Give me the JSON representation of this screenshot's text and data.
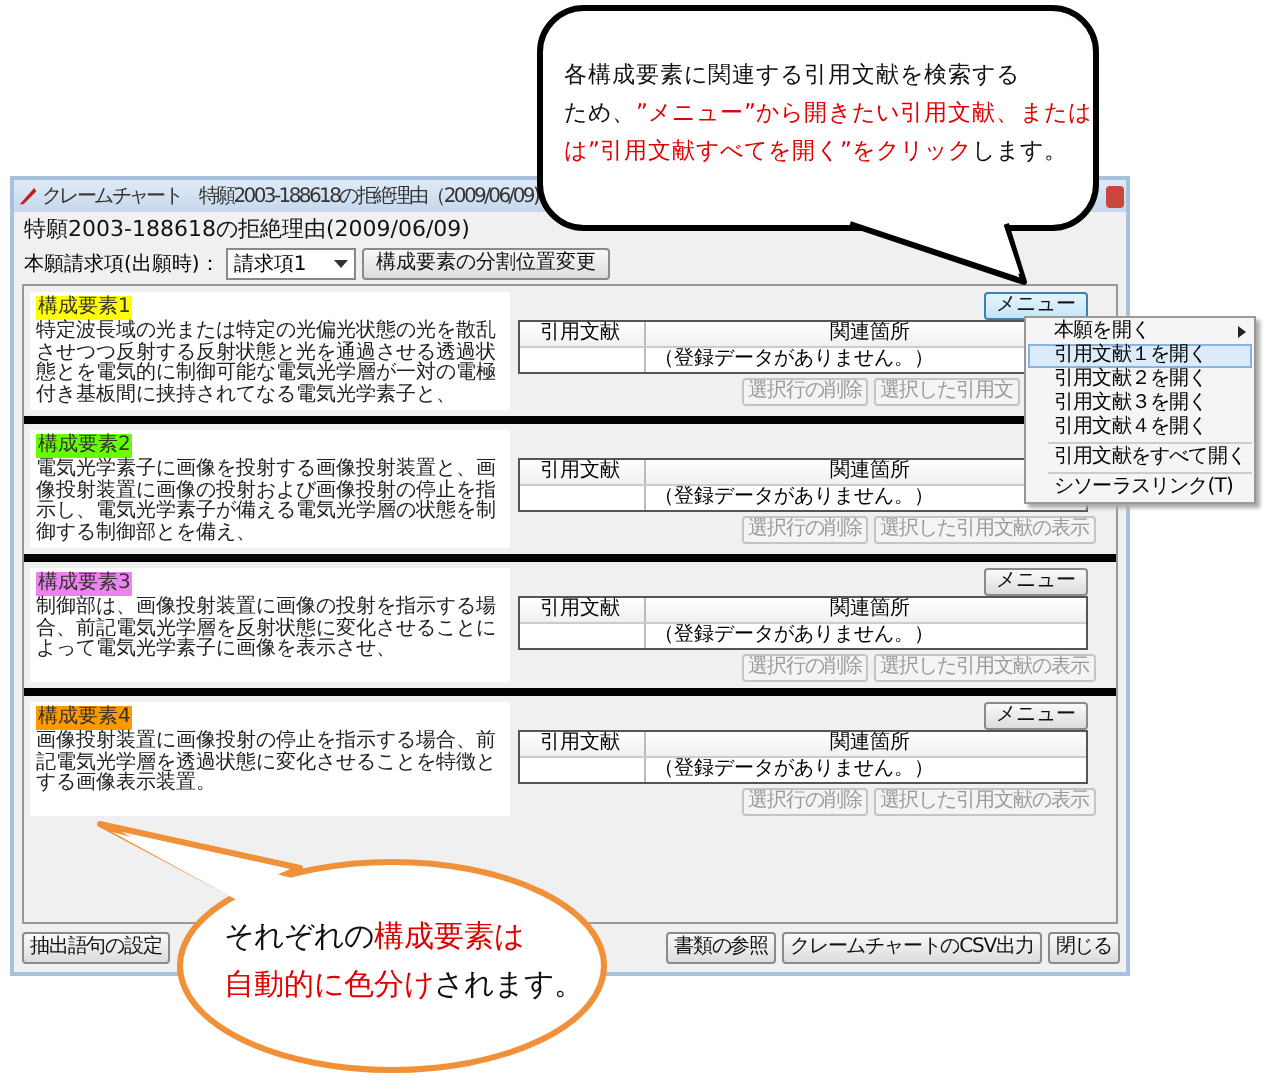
{
  "window": {
    "title": "クレームチャート　特願2003-188618の拒絶理由（2009/06/09)"
  },
  "heading": "特願2003-188618の拒絶理由(2009/06/09)",
  "claim_selector": {
    "label": "本願請求項(出願時)：",
    "value": "請求項1"
  },
  "split_button": "構成要素の分割位置変更",
  "sections": [
    {
      "label": "構成要素1",
      "color": "#ffff00",
      "text": "特定波長域の光または特定の光偏光状態の光を散乱させつつ反射する反射状態と光を通過させる透過状態とを電気的に制御可能な電気光学層が一対の電極付き基板間に挟持されてなる電気光学素子と、",
      "menu_button": {
        "label": "メニュー",
        "pressed": true
      },
      "columns": [
        "引用文献",
        "関連箇所"
      ],
      "empty_message": "（登録データがありません。）",
      "buttons": [
        {
          "label": "選択行の削除",
          "disabled": true
        },
        {
          "label": "選択した引用文",
          "disabled": true
        }
      ]
    },
    {
      "label": "構成要素2",
      "color": "#66ff00",
      "text": "電気光学素子に画像を投射する画像投射装置と、画像投射装置に画像の投射および画像投射の停止を指示し、電気光学素子が備える電気光学層の状態を制御する制御部とを備え、",
      "columns": [
        "引用文献",
        "関連箇所"
      ],
      "empty_message": "（登録データがありません。）",
      "buttons": [
        {
          "label": "選択行の削除",
          "disabled": true
        },
        {
          "label": "選択した引用文献の表示",
          "disabled": true
        }
      ]
    },
    {
      "label": "構成要素3",
      "color": "#ee82ee",
      "text": "制御部は、画像投射装置に画像の投射を指示する場合、前記電気光学層を反射状態に変化させることによって電気光学素子に画像を表示させ、",
      "menu_button": {
        "label": "メニュー",
        "pressed": false
      },
      "columns": [
        "引用文献",
        "関連箇所"
      ],
      "empty_message": "（登録データがありません。）",
      "buttons": [
        {
          "label": "選択行の削除",
          "disabled": true
        },
        {
          "label": "選択した引用文献の表示",
          "disabled": true
        }
      ]
    },
    {
      "label": "構成要素4",
      "color": "#ff9900",
      "text": "画像投射装置に画像投射の停止を指示する場合、前記電気光学層を透過状態に変化させることを特徴とする画像表示装置。",
      "menu_button": {
        "label": "メニュー",
        "pressed": false
      },
      "columns": [
        "引用文献",
        "関連箇所"
      ],
      "empty_message": "（登録データがありません。）",
      "buttons": [
        {
          "label": "選択行の削除",
          "disabled": true
        },
        {
          "label": "選択した引用文献の表示",
          "disabled": true
        }
      ]
    }
  ],
  "context_menu": {
    "items": [
      {
        "kind": "submenu",
        "label": "本願を開く",
        "selected": false
      },
      {
        "kind": "item",
        "label": "引用文献１を開く",
        "selected": true
      },
      {
        "kind": "item",
        "label": "引用文献２を開く",
        "selected": false
      },
      {
        "kind": "item",
        "label": "引用文献３を開く",
        "selected": false
      },
      {
        "kind": "item",
        "label": "引用文献４を開く",
        "selected": false
      },
      {
        "kind": "separator"
      },
      {
        "kind": "item",
        "label": "引用文献をすべて開く",
        "selected": false
      },
      {
        "kind": "separator"
      },
      {
        "kind": "item",
        "label": "シソーラスリンク(T)",
        "selected": false
      }
    ]
  },
  "footer_left_buttons": [
    "抽出語句の設定"
  ],
  "footer_right_buttons": [
    "書類の参照",
    "クレームチャートのCSV出力",
    "閉じる"
  ],
  "callouts": [
    {
      "kind": "speech",
      "lines": [
        [
          {
            "text": "各構成要素に関連する引用文献を検索する",
            "highlight": false
          }
        ],
        [
          {
            "text": "ため、",
            "highlight": false
          },
          {
            "text": "”メニュー”から開きたい引用文献、または",
            "highlight": true
          }
        ],
        [
          {
            "text": "は”引用文献すべてを開く”をクリック",
            "highlight": true
          },
          {
            "text": "します。",
            "highlight": false
          }
        ]
      ]
    },
    {
      "kind": "thought",
      "lines": [
        [
          {
            "text": "それぞれの",
            "highlight": false
          },
          {
            "text": "構成要素は",
            "highlight": true
          }
        ],
        [
          {
            "text": "自動的に色分け",
            "highlight": true
          },
          {
            "text": "されます。",
            "highlight": false
          }
        ]
      ]
    }
  ]
}
